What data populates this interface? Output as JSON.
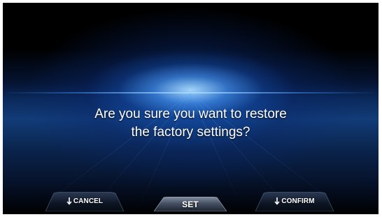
{
  "screen": {
    "message_line_1": "Are you sure you want to restore",
    "message_line_2": "the factory settings?"
  },
  "softkeys": {
    "left_label": "CANCEL",
    "left_icon": "down-arrow-icon",
    "middle_label": "SET",
    "right_label": "CONFIRM",
    "right_icon": "down-arrow-icon"
  },
  "colors": {
    "background": "#000000",
    "accent_blue": "#46a0ff",
    "text": "#ffffff"
  }
}
